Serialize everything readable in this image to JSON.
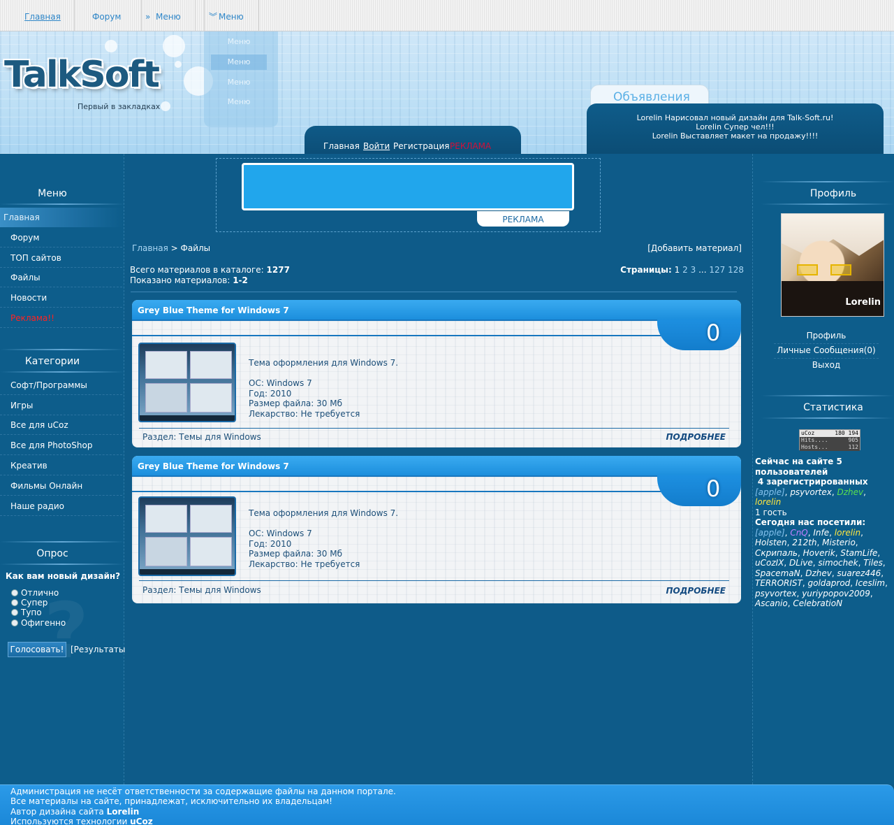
{
  "topnav": {
    "items": [
      {
        "label": "Главная"
      },
      {
        "label": "Форум"
      },
      {
        "label": "Меню"
      },
      {
        "label": "Меню"
      }
    ]
  },
  "header": {
    "logo": "TalkSoft",
    "slogan": "Первый в закладках",
    "dropdown": [
      "Меню",
      "Меню",
      "Меню",
      "Меню"
    ],
    "login": {
      "home": "Главная",
      "login": "Войти",
      "register": "Регистрация",
      "ad": "РЕКЛАМА"
    },
    "ads": {
      "title": "Объявления",
      "lines": [
        "Lorelin Нарисовал новый дизайн для Talk-Soft.ru!",
        "Lorelin Супер чел!!!",
        "Lorelin Выставляет макет на продажу!!!!"
      ]
    }
  },
  "left": {
    "menu_title": "Меню",
    "menu": [
      "Главная",
      "Форум",
      "ТОП сайтов",
      "Файлы",
      "Новости",
      "Реклама!!"
    ],
    "categories_title": "Категории",
    "categories": [
      "Софт/Программы",
      "Игры",
      "Все для uCoz",
      "Все для PhotoShop",
      "Креатив",
      "Фильмы Онлайн",
      "Наше радио"
    ],
    "poll_title": "Опрос",
    "poll_question": "Как вам новый дизайн?",
    "poll_options": [
      "Отлично",
      "Супер",
      "Тупо",
      "Офигенно"
    ],
    "vote": "Голосовать!",
    "results": "[Результаты]"
  },
  "center": {
    "banner_label": "РЕКЛАМА",
    "breadcrumb_home": "Главная",
    "breadcrumb_sep": " > ",
    "breadcrumb_current": "Файлы",
    "add_material": "[Добавить материал]",
    "total_label": "Всего материалов в каталоге: ",
    "total_value": "1277",
    "shown_label": "Показано материалов: ",
    "shown_value": "1-2",
    "pages_label": "Страницы:",
    "pages": [
      "1",
      "2",
      "3",
      "...",
      "127",
      "128"
    ],
    "entries": [
      {
        "title": "Grey Blue Theme for Windows 7",
        "count": "0",
        "desc": "Тема оформления для Windows 7.",
        "os": "ОС: Windows 7",
        "year": "Год: 2010",
        "size": "Размер файла: 30 Мб",
        "cure": "Лекарство: Не требуется",
        "section": "Раздел: Темы для Windows",
        "more": "ПОДРОБНЕЕ"
      },
      {
        "title": "Grey Blue Theme for Windows 7",
        "count": "0",
        "desc": "Тема оформления для Windows 7.",
        "os": "ОС: Windows 7",
        "year": "Год: 2010",
        "size": "Размер файла: 30 Мб",
        "cure": "Лекарство: Не требуется",
        "section": "Раздел: Темы для Windows",
        "more": "ПОДРОБНЕЕ"
      }
    ]
  },
  "right": {
    "profile_title": "Профиль",
    "avatar_name": "Lorelin",
    "links": [
      "Профиль",
      "Личные Сообщения(0)",
      "Выход"
    ],
    "stats_title": "Статистика",
    "counter": {
      "brand": "uCoz",
      "total": "180 194",
      "hits_label": "Hits....",
      "hits": "905",
      "hosts_label": "Hosts...",
      "hosts": "112"
    },
    "online_title": "Сейчас на сайте 5 пользователей",
    "online_registered": "4 зарегистрированных",
    "online_users": [
      "[apple]",
      "psyvortex",
      "Dzhev",
      "lorelin"
    ],
    "online_guests": "1 гость",
    "today_title": "Сегодня нас посетили:",
    "today_users": [
      "[apple]",
      "CnQ",
      "Infe",
      "lorelin",
      "Holsten",
      "212th",
      "Misterio",
      "Скрипаль",
      "Hoverik",
      "StamLife",
      "uCozIX",
      "DLive",
      "simochek",
      "Tiles",
      "SpacemaN",
      "Dzhev",
      "suarez446",
      "TERRORIST",
      "goldaprod",
      "Iceslim",
      "psyvortex",
      "yuriypopov2009",
      "Ascanio",
      "CelebratioN"
    ]
  },
  "footer": {
    "lines": [
      "Администрация не несёт ответственности за содержащие файлы на данном портале.",
      "Все материалы на сайте, принадлежат, исключительно их владельцам!"
    ],
    "author_label": "Автор дизайна сайта ",
    "author": "Lorelin",
    "tech_label": "Используются технологии ",
    "tech": "uCoz"
  }
}
